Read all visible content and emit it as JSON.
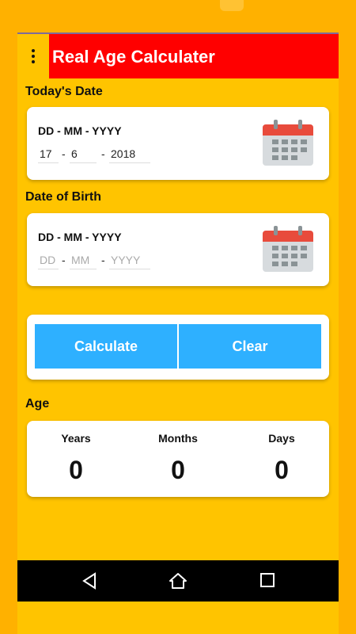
{
  "app": {
    "title": "Real Age Calculater"
  },
  "today": {
    "label": "Today's Date",
    "format": "DD - MM - YYYY",
    "day": "17",
    "month": "6",
    "year": "2018"
  },
  "dob": {
    "label": "Date of Birth",
    "format": "DD - MM - YYYY",
    "day_placeholder": "DD",
    "month_placeholder": "MM",
    "year_placeholder": "YYYY"
  },
  "separator": "-",
  "buttons": {
    "calculate": "Calculate",
    "clear": "Clear"
  },
  "age": {
    "label": "Age",
    "years_label": "Years",
    "months_label": "Months",
    "days_label": "Days",
    "years": "0",
    "months": "0",
    "days": "0"
  },
  "icons": {
    "menu": "more-vert-icon",
    "calendar": "calendar-icon",
    "back": "back-triangle-icon",
    "home": "home-icon",
    "recents": "recents-square-icon"
  },
  "colors": {
    "background": "#FFB100",
    "app_bar": "#FF0000",
    "button": "#2EB0FF"
  }
}
